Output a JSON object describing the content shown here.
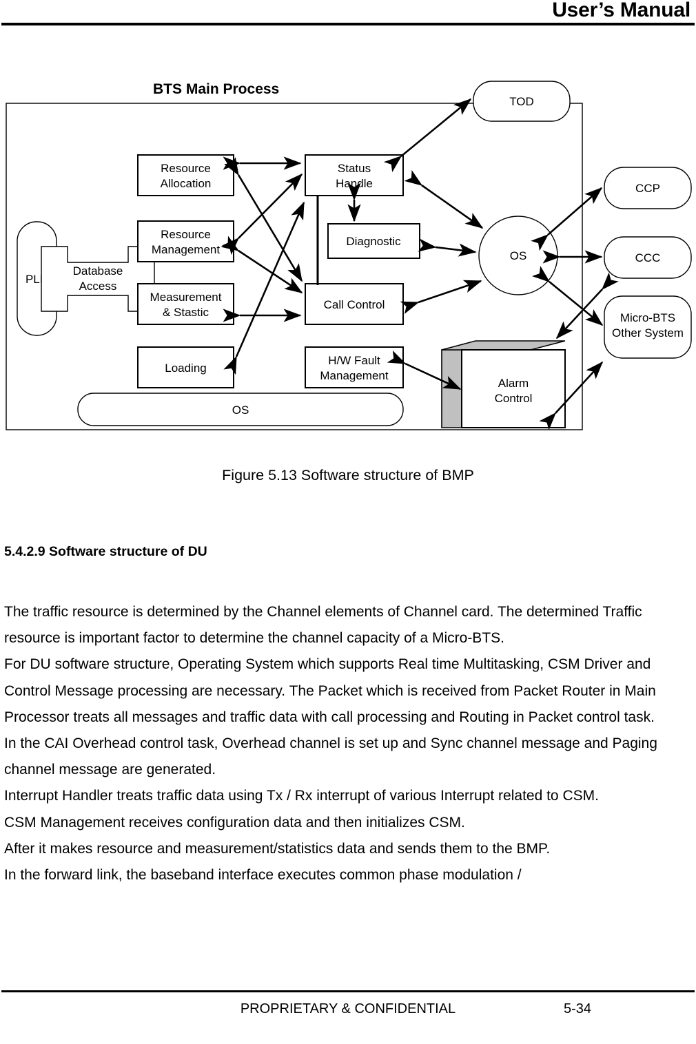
{
  "header": {
    "title": "User’s Manual"
  },
  "figure": {
    "diagram_title": "BTS Main Process",
    "caption": "Figure 5.13 Software structure of BMP",
    "nodes": {
      "pld": "PLD",
      "database_access": "Database\nAccess",
      "database_access_line1": "Database",
      "database_access_line2": "Access",
      "resource_allocation_line1": "Resource",
      "resource_allocation_line2": "Allocation",
      "resource_management_line1": "Resource",
      "resource_management_line2": "Management",
      "measurement_line1": "Measurement",
      "measurement_line2": "& Stastic",
      "loading": "Loading",
      "status_handle_line1": "Status",
      "status_handle_line2": "Handle",
      "diagnostic": "Diagnostic",
      "call_control": "Call Control",
      "hw_fault_line1": "H/W Fault",
      "hw_fault_line2": "Management",
      "os_bar": "OS",
      "os_circle": "OS",
      "alarm_control_line1": "Alarm",
      "alarm_control_line2": "Control",
      "tod": "TOD",
      "ccp": "CCP",
      "ccc": "CCC",
      "micro_bts_line1": "Micro-BTS",
      "micro_bts_line2": "Other System"
    },
    "colors": {
      "line": "#000000",
      "box_fill": "#ffffff",
      "alarm_shade": "#c0c0c0",
      "page_background": "#ffffff"
    }
  },
  "section": {
    "heading": "5.4.2.9 Software structure of DU"
  },
  "body": {
    "paragraphs": [
      "The traffic resource is determined by the Channel elements of Channel card. The determined Traffic resource is important factor to determine the channel capacity of a Micro-BTS.",
      "For DU software structure, Operating System which supports Real time Multitasking, CSM Driver and Control Message processing are necessary. The Packet which is received from Packet Router in Main Processor treats all messages and traffic data with call processing and Routing in Packet control task.",
      "In the CAI Overhead control task, Overhead channel is set up and Sync channel message and Paging channel message are generated.",
      "Interrupt Handler treats traffic data using Tx / Rx interrupt of various Interrupt related to CSM.",
      "CSM Management receives configuration data and then initializes CSM.",
      "After it makes resource and measurement/statistics data and sends them to the BMP.",
      "In the forward link, the baseband interface executes common phase modulation /"
    ]
  },
  "footer": {
    "confidential": "PROPRIETARY & CONFIDENTIAL",
    "page_number": "5-34"
  }
}
